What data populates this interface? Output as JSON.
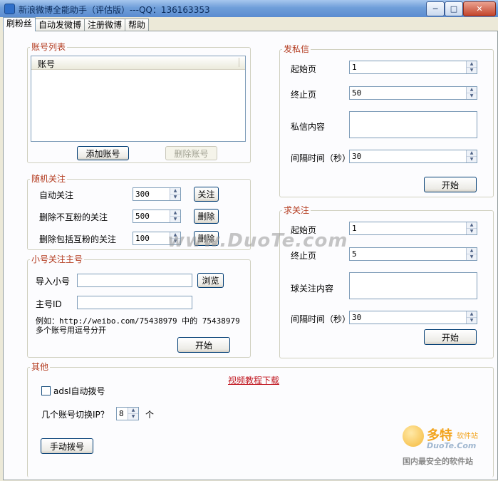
{
  "window": {
    "title": "新浪微博全能助手（评估版）---QQ：136163353",
    "min_label": "─",
    "max_label": "□",
    "close_label": "✕"
  },
  "tabs": [
    "刷粉丝",
    "自动发微博",
    "注册微博",
    "帮助"
  ],
  "accounts": {
    "title": "账号列表",
    "column": "账号",
    "add_button": "添加账号",
    "delete_button": "删除账号"
  },
  "random_follow": {
    "title": "随机关注",
    "rows": [
      {
        "label": "自动关注",
        "value": "300",
        "button": "关注"
      },
      {
        "label": "删除不互粉的关注",
        "value": "500",
        "button": "删除"
      },
      {
        "label": "删除包括互粉的关注",
        "value": "100",
        "button": "删除"
      }
    ]
  },
  "small_follow": {
    "title": "小号关注主号",
    "import_label": "导入小号",
    "import_value": "",
    "browse_button": "浏览",
    "main_id_label": "主号ID",
    "main_id_value": "",
    "example_line1": "例如：http://weibo.com/75438979 中的 75438979",
    "example_line2": "多个账号用逗号分开",
    "start_button": "开始"
  },
  "private_msg": {
    "title": "发私信",
    "start_page_label": "起始页",
    "start_page_value": "1",
    "end_page_label": "终止页",
    "end_page_value": "50",
    "content_label": "私信内容",
    "content_value": "",
    "interval_label": "间隔时间（秒）",
    "interval_value": "30",
    "start_button": "开始"
  },
  "seek_follow": {
    "title": "求关注",
    "start_page_label": "起始页",
    "start_page_value": "1",
    "end_page_label": "终止页",
    "end_page_value": "5",
    "content_label": "球关注内容",
    "content_value": "",
    "interval_label": "间隔时间（秒）",
    "interval_value": "30",
    "start_button": "开始"
  },
  "other": {
    "title": "其他",
    "video_link": "视频教程下载",
    "adsl_label": "adsl自动拨号",
    "adsl_checked": false,
    "switch_ip_label": "几个账号切换IP？",
    "switch_ip_value": "8",
    "switch_ip_unit": "个",
    "manual_dial_button": "手动拨号"
  },
  "watermark": {
    "center": "www.DuoTe.com",
    "logo_cn": "多特",
    "logo_sub": "软件站",
    "logo_en": "DuoTe.Com",
    "logo_slogan": "国内最安全的软件站"
  },
  "colors": {
    "group_title": "#b33a1e",
    "link": "#c0151e",
    "title_bar": "#6f9ed9"
  }
}
